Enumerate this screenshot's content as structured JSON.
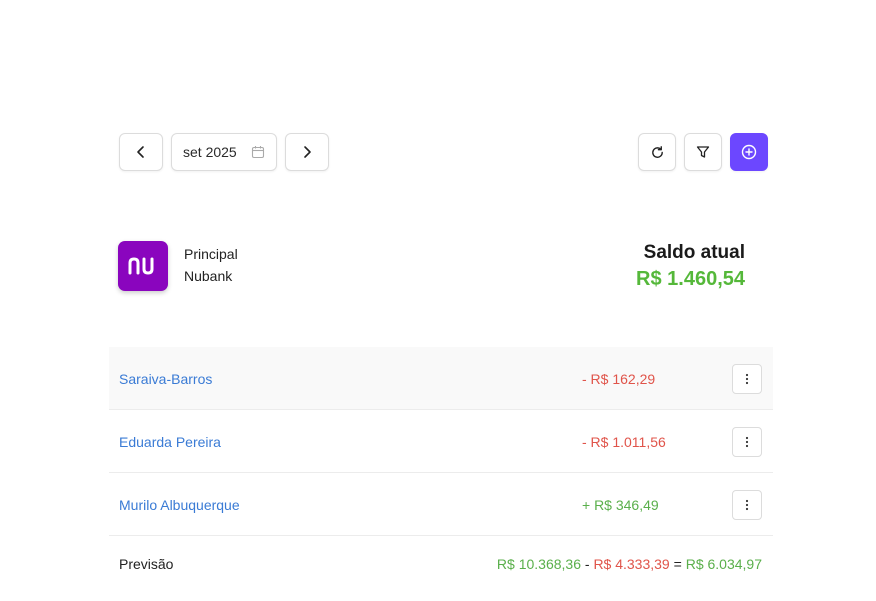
{
  "nav": {
    "month_label": "set 2025"
  },
  "account": {
    "name": "Principal",
    "bank": "Nubank",
    "logo_text": "nu",
    "brand_color": "#8a05be"
  },
  "balance": {
    "label": "Saldo atual",
    "value": "R$ 1.460,54"
  },
  "colors": {
    "accent": "#6c47ff",
    "positive": "#5aaf4b",
    "negative": "#e0544a",
    "link": "#3a7bd5"
  },
  "transactions": [
    {
      "name": "Saraiva-Barros",
      "amount": "- R$ 162,29",
      "sign": "negative"
    },
    {
      "name": "Eduarda Pereira",
      "amount": "- R$ 1.011,56",
      "sign": "negative"
    },
    {
      "name": "Murilo Albuquerque",
      "amount": "+ R$ 346,49",
      "sign": "positive"
    }
  ],
  "forecast": {
    "label": "Previsão",
    "income": "R$ 10.368,36",
    "minus": "-",
    "expense": "R$ 4.333,39",
    "equals": "=",
    "result": "R$ 6.034,97"
  },
  "icons": {
    "prev": "chevron-left-icon",
    "next": "chevron-right-icon",
    "calendar": "calendar-icon",
    "refresh": "refresh-icon",
    "filter": "filter-icon",
    "add": "plus-circle-icon",
    "row_menu": "more-vertical-icon"
  }
}
